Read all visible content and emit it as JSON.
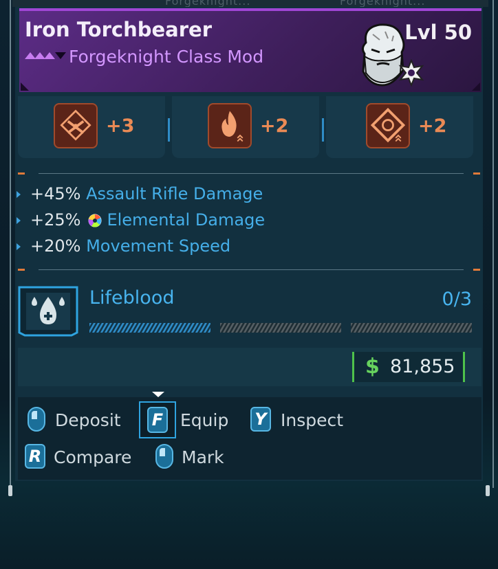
{
  "background_tabs": [
    "Forgeknight...",
    "Forgeknight..."
  ],
  "item": {
    "name": "Iron Torchbearer",
    "type": "Forgeknight Class Mod",
    "level": "Lvl 50",
    "rarity_color": "#a046d6"
  },
  "skills": [
    {
      "icon": "crossed-guns-skill-icon",
      "bonus": "+3"
    },
    {
      "icon": "flame-skill-icon",
      "bonus": "+2"
    },
    {
      "icon": "diamond-burst-skill-icon",
      "bonus": "+2"
    }
  ],
  "stats": [
    {
      "value": "+45%",
      "name": "Assault Rifle Damage",
      "icon": ""
    },
    {
      "value": "+25%",
      "name": "Elemental Damage",
      "icon": "elemental-icon"
    },
    {
      "value": "+20%",
      "name": "Movement Speed",
      "icon": ""
    }
  ],
  "ability": {
    "name": "Lifeblood",
    "count": "0/3",
    "icon": "lifeblood-drop-icon"
  },
  "money": {
    "symbol": "$",
    "amount": "81,855"
  },
  "actions": {
    "deposit": "Deposit",
    "equip_key": "F",
    "equip": "Equip",
    "inspect_key": "Y",
    "inspect": "Inspect",
    "compare_key": "R",
    "compare": "Compare",
    "mark": "Mark"
  },
  "colors": {
    "accent_blue": "#45aee8",
    "skill_orange": "#ea8a55",
    "money_green": "#67d35e",
    "purple_header": "#5c2c86"
  }
}
